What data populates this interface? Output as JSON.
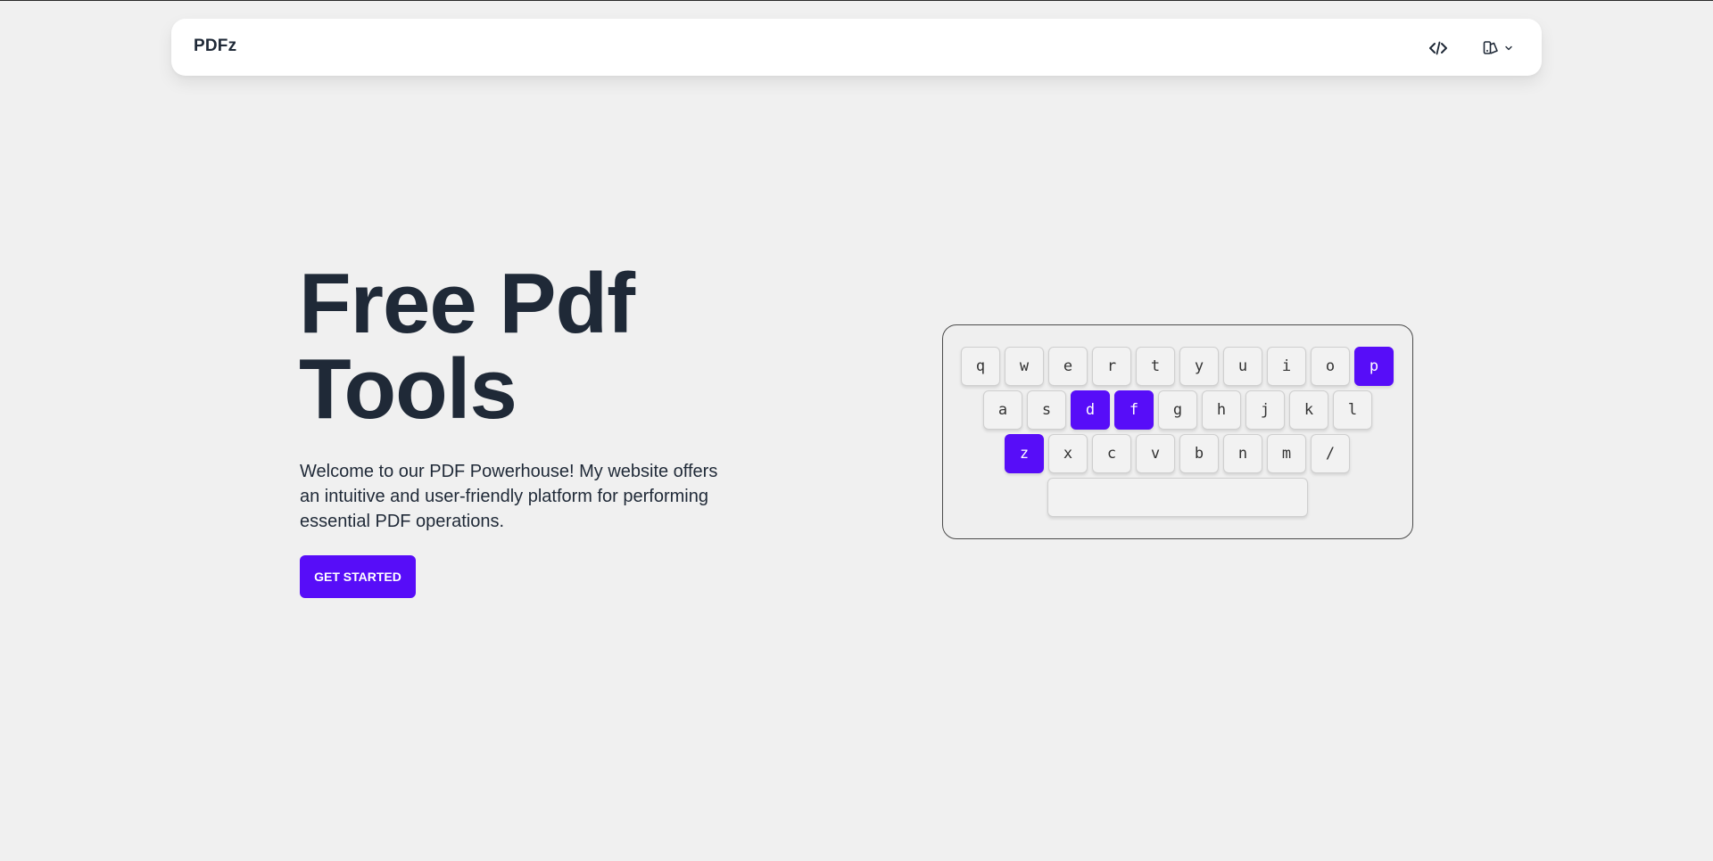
{
  "navbar": {
    "brand": "PDFz",
    "code_icon": "code-icon",
    "theme_icon": "theme-palette-icon",
    "chevron_icon": "chevron-down-icon"
  },
  "hero": {
    "title_line1": "Free Pdf",
    "title_line2": "Tools",
    "description": "Welcome to our PDF Powerhouse! My website offers an intuitive and user-friendly platform for performing essential PDF operations.",
    "cta_label": "GET STARTED"
  },
  "keyboard": {
    "rows": [
      [
        "q",
        "w",
        "e",
        "r",
        "t",
        "y",
        "u",
        "i",
        "o",
        "p"
      ],
      [
        "a",
        "s",
        "d",
        "f",
        "g",
        "h",
        "j",
        "k",
        "l"
      ],
      [
        "z",
        "x",
        "c",
        "v",
        "b",
        "n",
        "m",
        "/"
      ]
    ],
    "highlighted": [
      "p",
      "d",
      "f",
      "z"
    ]
  },
  "colors": {
    "accent": "#570df8",
    "background": "#f0f0f0",
    "text": "#1f2937"
  }
}
